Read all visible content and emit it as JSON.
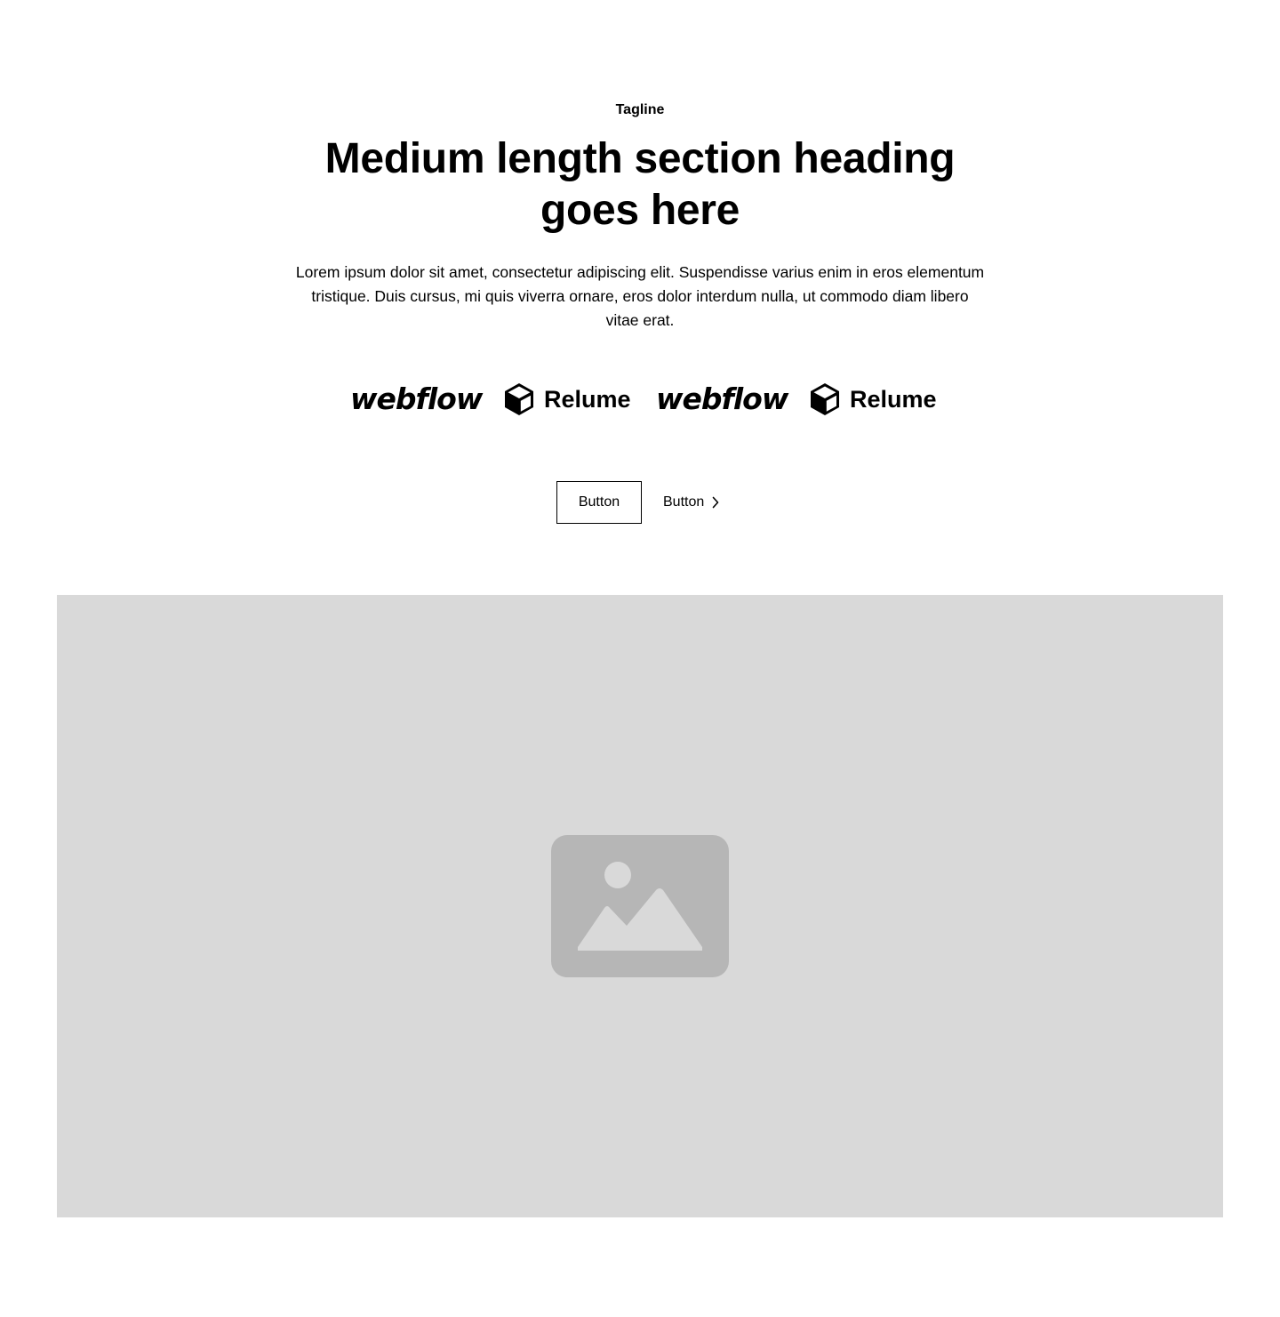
{
  "header": {
    "tagline": "Tagline",
    "heading": "Medium length section heading goes here",
    "description": "Lorem ipsum dolor sit amet, consectetur adipiscing elit. Suspendisse varius enim in eros elementum tristique. Duis cursus, mi quis viverra ornare, eros dolor interdum nulla, ut commodo diam libero vitae erat."
  },
  "logos": [
    {
      "name": "webflow",
      "text": "webflow",
      "icon": null
    },
    {
      "name": "relume",
      "text": "Relume",
      "icon": "cube-icon"
    },
    {
      "name": "webflow",
      "text": "webflow",
      "icon": null
    },
    {
      "name": "relume",
      "text": "Relume",
      "icon": "cube-icon"
    }
  ],
  "actions": {
    "primary_label": "Button",
    "link_label": "Button",
    "link_icon": "chevron-right-icon"
  },
  "image": {
    "icon": "image-placeholder-icon"
  },
  "colors": {
    "background": "#ffffff",
    "text": "#000000",
    "placeholder_bg": "#d9d9d9",
    "placeholder_icon": "#b6b6b6"
  }
}
